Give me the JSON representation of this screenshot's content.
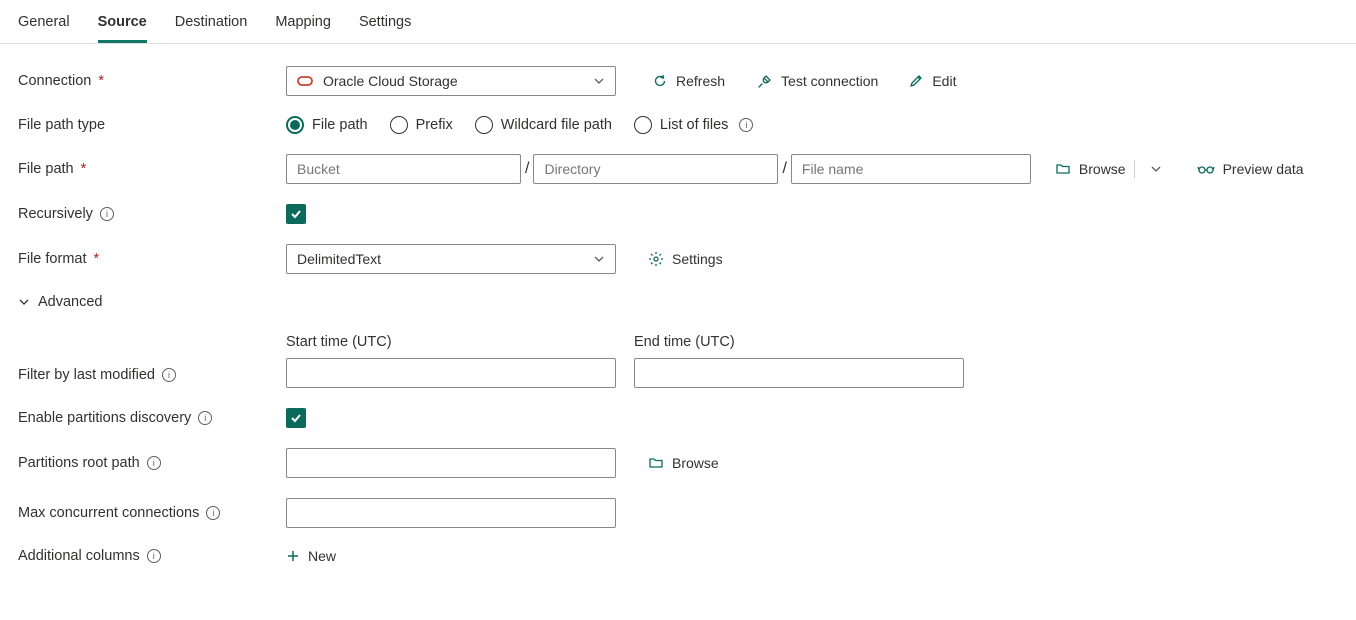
{
  "tabs": {
    "general": "General",
    "source": "Source",
    "destination": "Destination",
    "mapping": "Mapping",
    "settings": "Settings"
  },
  "labels": {
    "connection": "Connection",
    "file_path_type": "File path type",
    "file_path": "File path",
    "recursively": "Recursively",
    "file_format": "File format",
    "advanced": "Advanced",
    "filter_by_last_modified": "Filter by last modified",
    "enable_partitions_discovery": "Enable partitions discovery",
    "partitions_root_path": "Partitions root path",
    "max_concurrent_connections": "Max concurrent connections",
    "additional_columns": "Additional columns"
  },
  "connection": {
    "value": "Oracle Cloud Storage",
    "refresh": "Refresh",
    "test": "Test connection",
    "edit": "Edit"
  },
  "file_path_type": {
    "file_path": "File path",
    "prefix": "Prefix",
    "wildcard": "Wildcard file path",
    "list_of_files": "List of files"
  },
  "file_path": {
    "bucket_ph": "Bucket",
    "directory_ph": "Directory",
    "filename_ph": "File name",
    "browse": "Browse",
    "preview": "Preview data",
    "sep": "/"
  },
  "file_format": {
    "value": "DelimitedText",
    "settings": "Settings"
  },
  "filter": {
    "start_label": "Start time (UTC)",
    "end_label": "End time (UTC)"
  },
  "partitions": {
    "browse": "Browse"
  },
  "additional_columns": {
    "new": "New"
  }
}
